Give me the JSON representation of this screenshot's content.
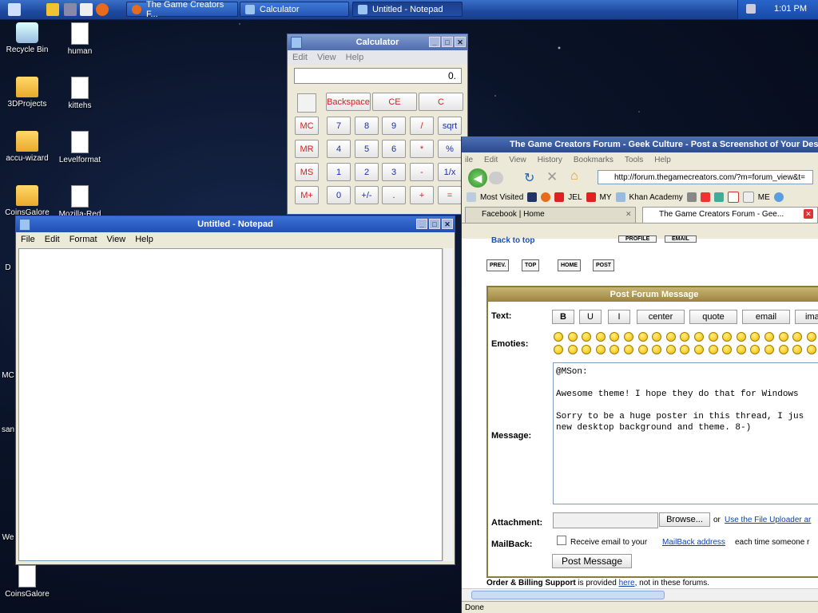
{
  "taskbar": {
    "tasks": [
      {
        "label": "The Game Creators F...",
        "color": "#e86a1c"
      },
      {
        "label": "Calculator",
        "color": "#9cc4f0"
      },
      {
        "label": "Untitled - Notepad",
        "color": "#9cc4f0"
      }
    ],
    "clock": "1:01 PM"
  },
  "desktop": {
    "icons": [
      "Recycle Bin",
      "human",
      "3DProjects",
      "kittehs",
      "accu-wizard",
      "Levelformat",
      "CoinsGalore",
      "Mozilla-Red",
      "CoinsGalore"
    ],
    "edge_labels": [
      "D",
      "MC",
      "san",
      "We"
    ]
  },
  "calculator": {
    "title": "Calculator",
    "menu": [
      "Edit",
      "View",
      "Help"
    ],
    "display": "0.",
    "top_buttons": [
      "Backspace",
      "CE",
      "C"
    ],
    "memory_buttons": [
      "MC",
      "MR",
      "MS",
      "M+"
    ],
    "rows": [
      [
        "7",
        "8",
        "9",
        "/",
        "sqrt"
      ],
      [
        "4",
        "5",
        "6",
        "*",
        "%"
      ],
      [
        "1",
        "2",
        "3",
        "-",
        "1/x"
      ],
      [
        "0",
        "+/-",
        ".",
        "+",
        "="
      ]
    ]
  },
  "notepad": {
    "title": "Untitled - Notepad",
    "menu": [
      "File",
      "Edit",
      "Format",
      "View",
      "Help"
    ]
  },
  "firefox": {
    "title": "The Game Creators Forum - Geek Culture - Post a Screenshot of Your Desktop",
    "menu": [
      "ile",
      "Edit",
      "View",
      "History",
      "Bookmarks",
      "Tools",
      "Help"
    ],
    "url": "http://forum.thegamecreators.com/?m=forum_view&t=",
    "bookmarks": [
      "Most Visited",
      "JEL",
      "MY",
      "Khan Academy",
      "ME"
    ],
    "tabs": [
      "Facebook | Home",
      "The Game Creators Forum - Gee..."
    ],
    "back_to_top": "Back to top",
    "top_buttons": [
      "PROFILE",
      "EMAIL"
    ],
    "nav_buttons": [
      "PREV.",
      "TOP",
      "HOME",
      "POST"
    ],
    "form_title": "Post Forum Message",
    "labels": {
      "text": "Text:",
      "emoties": "Emoties:",
      "message": "Message:",
      "attachment": "Attachment:",
      "mailback": "MailBack:"
    },
    "format_buttons": [
      "B",
      "U",
      "I",
      "center",
      "quote",
      "email",
      "ima"
    ],
    "message_text": "@MSon:\n\nAwesome theme! I hope they do that for Windows\n\nSorry to be a huge poster in this thread, I jus\nnew desktop background and theme. 8-)",
    "browse_label": "Browse...",
    "or_text": "or",
    "uploader_link": "Use the File Uploader ar",
    "mailback_prefix": "Receive email to your",
    "mailback_link": "MailBack address",
    "mailback_suffix": "each time someone r",
    "post_button": "Post Message",
    "billing_bold": "Order & Billing Support",
    "billing_mid": "is provided",
    "billing_link": "here",
    "billing_end": ", not in these forums.",
    "status": "Done"
  }
}
